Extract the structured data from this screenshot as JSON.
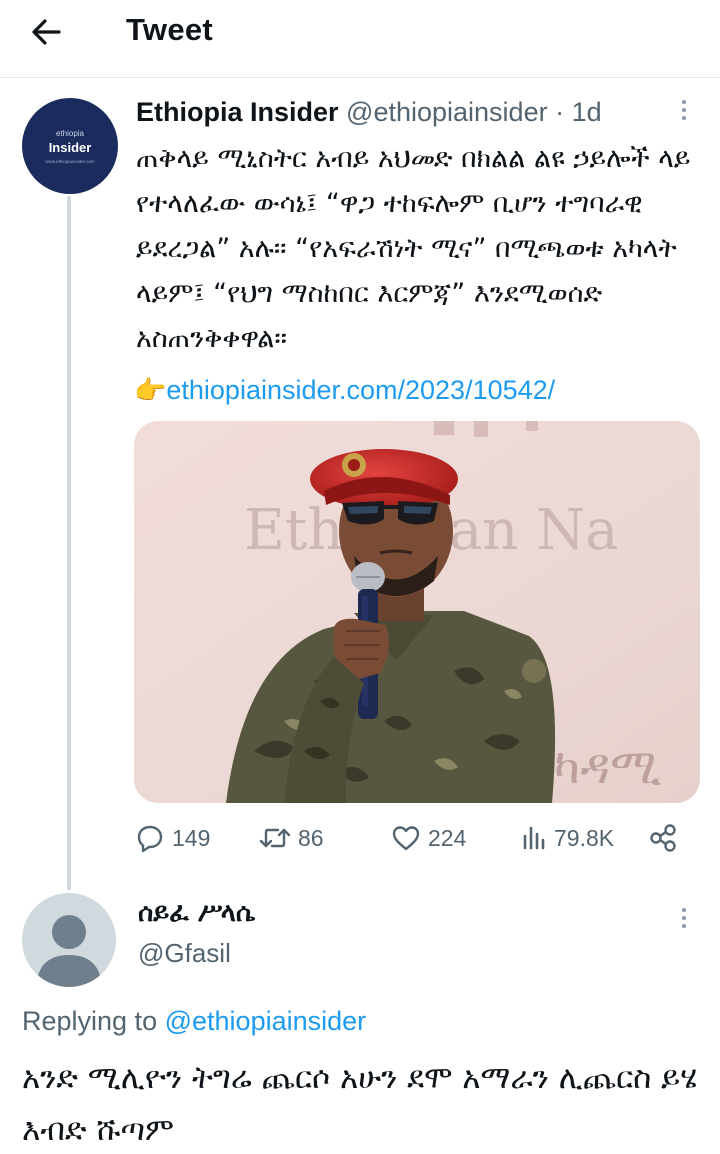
{
  "header": {
    "title": "Tweet",
    "back_icon": "arrow-left-icon"
  },
  "tweet": {
    "author_name": "Ethiopia Insider",
    "author_handle": "@ethiopiainsider",
    "separator": "·",
    "time": "1d",
    "avatar": {
      "line1": "ethiopia",
      "line2": "Insider",
      "line3": "www.ethiopiainsider.com"
    },
    "text": "ጠቅላይ ሚኒስትር አብይ አህመድ በክልል ልዩ ኃይሎች ላይ የተላለፈው ውሳኔ፤ “ዋጋ ተከፍሎም ቢሆን ተግባራዊ ይደረጋል” አሉ። “የአፍራሽነት ሚና” በሚጫወቱ አካላት ላይም፤ “የህግ ማስከበር እርምጃ” እንደሚወሰድ አስጠንቅቀዋል።",
    "link_emoji": "👉",
    "link": "ethiopiainsider.com/2023/10542/",
    "media": {
      "banner_text": "Ethiopian Na",
      "bottom_text": "ካዳሚ"
    },
    "stats": {
      "replies": "149",
      "retweets": "86",
      "likes": "224",
      "views": "79.8K"
    }
  },
  "reply": {
    "author_name": "ሰይፈ ሥላሴ",
    "author_handle": "@Gfasil",
    "replying_prefix": "Replying to",
    "replying_handle": "@ethiopiainsider",
    "text": "አንድ ሚሊዮን ትግሬ ጨርሶ አሁን ደሞ አማራን ሊጨርስ ይሄ እብድ ሹጣም"
  },
  "colors": {
    "accent": "#1d9bf0",
    "secondary_text": "#536471",
    "thread_line": "#cfd9de",
    "avatar_bg": "#1b2b5e"
  }
}
